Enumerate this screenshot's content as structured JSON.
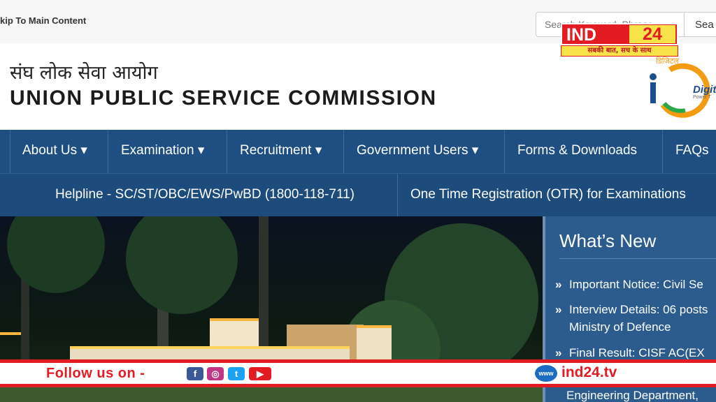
{
  "topbar": {
    "skip_link": "kip To Main Content",
    "search_placeholder": "Search Keyword, Phrase",
    "search_button": "Sea"
  },
  "header": {
    "hindi_title": "संघ लोक सेवा आयोग",
    "english_title": "UNION PUBLIC SERVICE COMMISSION",
    "digital_india_hindi": "डिजिटल",
    "digital_india_text": "Digit",
    "digital_india_tagline": "Power T"
  },
  "nav": {
    "items": [
      {
        "label": "About Us ▾"
      },
      {
        "label": "Examination ▾"
      },
      {
        "label": "Recruitment ▾"
      },
      {
        "label": "Government Users ▾"
      },
      {
        "label": "Forms & Downloads"
      },
      {
        "label": "FAQs"
      }
    ],
    "sub_items": [
      {
        "label": "Helpline - SC/ST/OBC/EWS/PwBD (1800-118-711)"
      },
      {
        "label": "One Time Registration (OTR) for Examinations"
      }
    ]
  },
  "whats_new": {
    "title": "What’s New",
    "items": [
      {
        "line1": "Important Notice: Civil Se",
        "line2": ""
      },
      {
        "line1": "Interview Details: 06 posts",
        "line2": "Ministry of Defence"
      },
      {
        "line1": "Final Result: CISF AC(EX",
        "line2": ""
      }
    ],
    "partial_text": "Engineering Department,"
  },
  "overlay": {
    "brand_name": "IND",
    "brand_number": "24",
    "brand_tagline": "सबकी बात, सच के साथ",
    "follow_text": "Follow us on -",
    "social_icons": [
      "facebook-icon",
      "instagram-icon",
      "twitter-icon",
      "youtube-icon"
    ],
    "www_label": "www",
    "domain": "ind24.tv",
    "accent_color": "#e31b23"
  }
}
